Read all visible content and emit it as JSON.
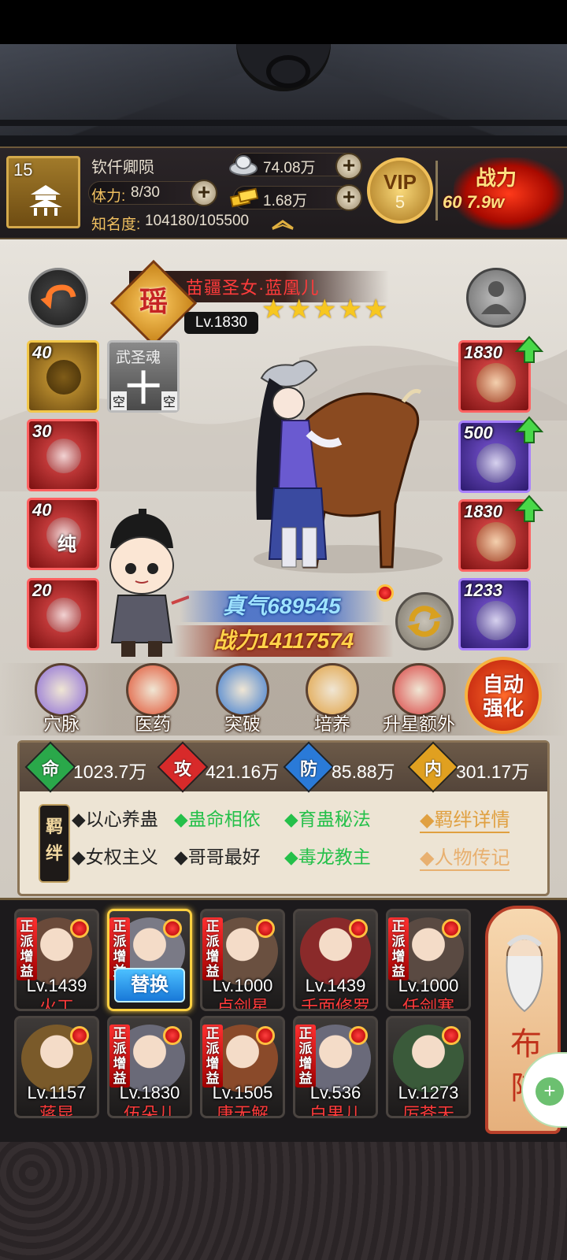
{
  "player": {
    "level": "15",
    "name": "钦仟卿陨",
    "stamina_label": "体力:",
    "stamina_value": "8/30",
    "fame_label": "知名度:",
    "fame_value": "104180/105500",
    "silver": "74.08万",
    "gold": "1.68万",
    "vip_label": "VIP",
    "vip_level": "5",
    "power_label": "战力",
    "power_value": "60 7.9w"
  },
  "hero": {
    "faction_char": "瑶",
    "name": "苗疆圣女·蓝凰儿",
    "level": "Lv.1830",
    "stars": 5,
    "zhenqi_label": "真气",
    "zhenqi_value": "689545",
    "power_label": "战力",
    "power_value": "14117574"
  },
  "left_slots": [
    {
      "num": "40",
      "style": "gold"
    },
    {
      "num": "30",
      "style": "red"
    },
    {
      "num": "40",
      "style": "red",
      "glyph": "纯"
    },
    {
      "num": "20",
      "style": "red"
    }
  ],
  "soul_slot": {
    "title": "武圣魂",
    "glyph": "十",
    "left": "空",
    "right": "空"
  },
  "right_slots": [
    {
      "num": "1830",
      "style": "red",
      "upgrade": true
    },
    {
      "num": "500",
      "style": "purple",
      "upgrade": true
    },
    {
      "num": "1830",
      "style": "red",
      "upgrade": true
    },
    {
      "num": "1233",
      "style": "purple",
      "upgrade": false
    }
  ],
  "actions": [
    {
      "label": "穴脉",
      "icon": "meridian-icon"
    },
    {
      "label": "医药",
      "icon": "medicine-icon"
    },
    {
      "label": "突破",
      "icon": "breakthrough-icon"
    },
    {
      "label": "培养",
      "icon": "cultivate-icon"
    },
    {
      "label": "升星额外",
      "icon": "star-up-icon"
    }
  ],
  "auto_button": {
    "line1": "自动",
    "line2": "强化"
  },
  "stats": [
    {
      "ch": "命",
      "value": "1023.7万",
      "color": "#2aa84a"
    },
    {
      "ch": "攻",
      "value": "421.16万",
      "color": "#d82a2a"
    },
    {
      "ch": "防",
      "value": "85.88万",
      "color": "#2a7ad8"
    },
    {
      "ch": "内",
      "value": "301.17万",
      "color": "#e0a020"
    }
  ],
  "bond_tag": "羁绊",
  "bonds": [
    {
      "text": "◆以心养蛊",
      "active": false
    },
    {
      "text": "◆蛊命相依",
      "active": true
    },
    {
      "text": "◆育蛊秘法",
      "active": true
    },
    {
      "text": "◆女权主义",
      "active": false
    },
    {
      "text": "◆哥哥最好",
      "active": false
    },
    {
      "text": "◆毒龙教主",
      "active": true
    }
  ],
  "links": {
    "bond_detail": "◆羁绊详情",
    "biography": "◆人物传记"
  },
  "roster": [
    {
      "lv": "Lv.1439",
      "name": "火工",
      "badge": "正派增益",
      "tone": "#6a4a3a"
    },
    {
      "lv": "",
      "name": "",
      "badge": "正派增益",
      "tone": "#7a7a86",
      "selected": true
    },
    {
      "lv": "Lv.1000",
      "name": "卢剑星",
      "badge": "正派增益",
      "tone": "#6a5040"
    },
    {
      "lv": "Lv.1439",
      "name": "千面修罗",
      "badge": "",
      "tone": "#8a2a2a"
    },
    {
      "lv": "Lv.1000",
      "name": "任剑寒",
      "badge": "正派增益",
      "tone": "#5a4a42"
    },
    {
      "lv": "Lv.1157",
      "name": "蒋昆",
      "badge": "",
      "tone": "#7a5a2a"
    },
    {
      "lv": "Lv.1830",
      "name": "伍朵儿",
      "badge": "正派增益",
      "tone": "#6a6a78"
    },
    {
      "lv": "Lv.1505",
      "name": "唐无解",
      "badge": "正派增益",
      "tone": "#8a4a2a"
    },
    {
      "lv": "Lv.536",
      "name": "白果儿",
      "badge": "正派增益",
      "tone": "#6a6a7a"
    },
    {
      "lv": "Lv.1273",
      "name": "厉苍天",
      "badge": "",
      "tone": "#3a5a3a"
    }
  ],
  "replace_label": "替换",
  "buzhen_label": "布阵"
}
